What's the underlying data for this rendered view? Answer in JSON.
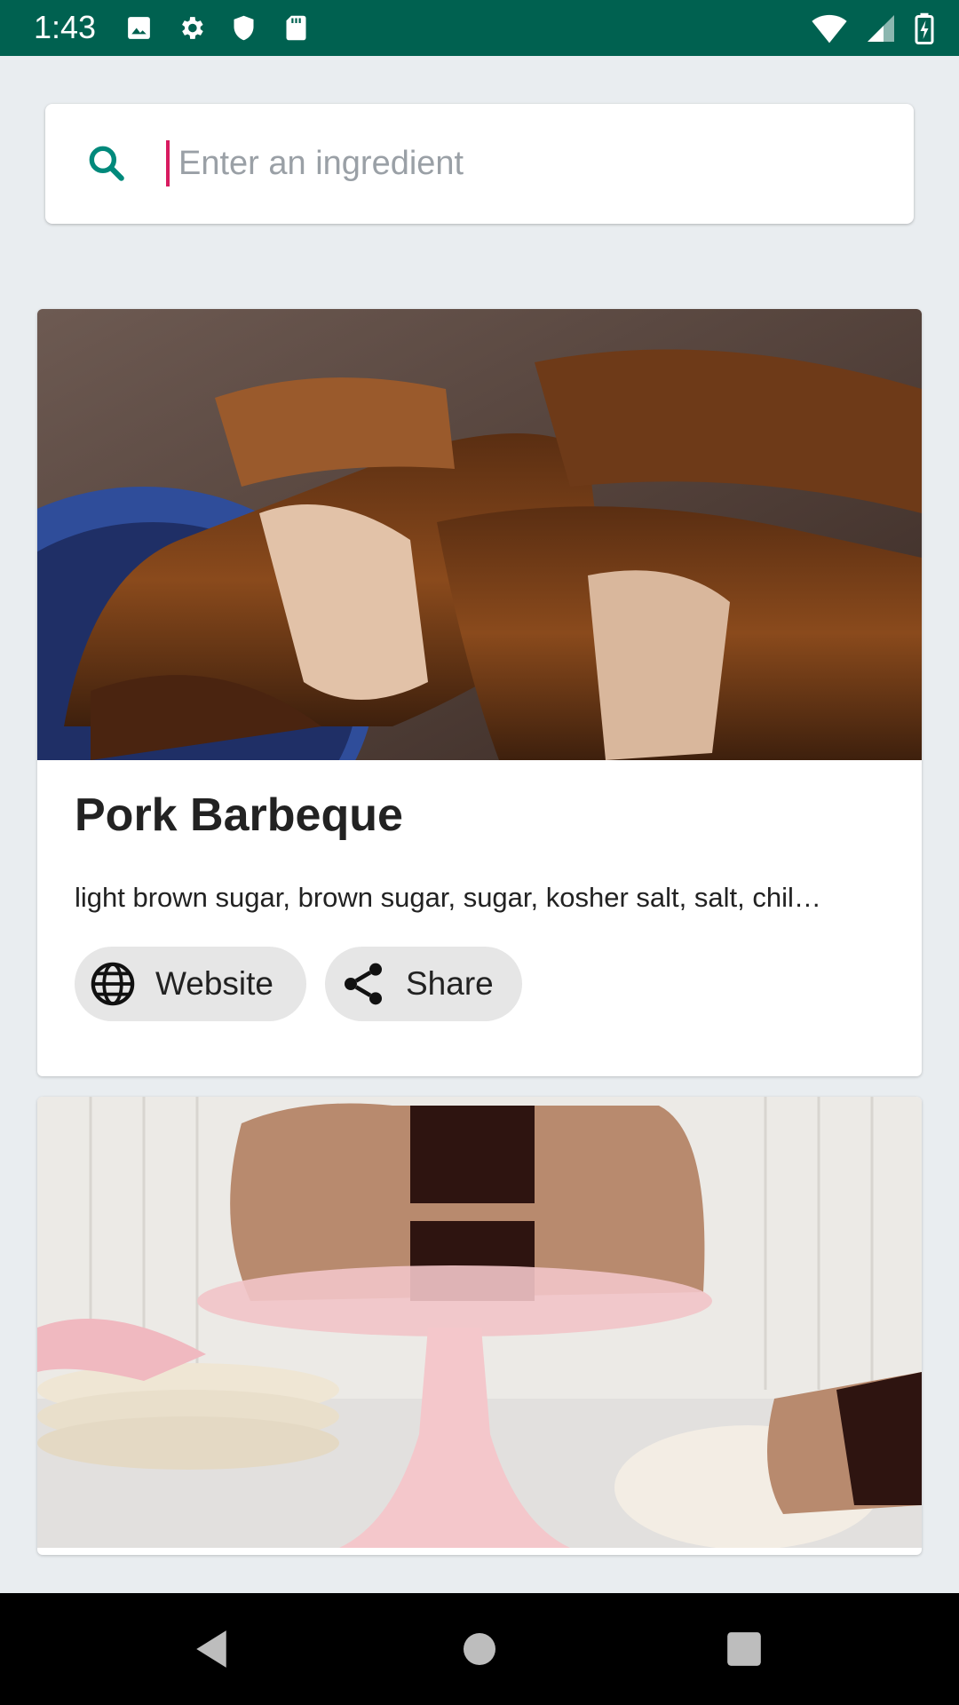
{
  "status_bar": {
    "time": "1:43",
    "left_icons": [
      "image-icon",
      "gear-icon",
      "shield-icon",
      "sd-card-icon"
    ],
    "right_icons": [
      "wifi-icon",
      "signal-icon",
      "battery-icon"
    ],
    "background_color": "#006150"
  },
  "search": {
    "placeholder": "Enter an ingredient",
    "value": "",
    "icon": "search-icon",
    "icon_color": "#00897b",
    "caret_color": "#d81b60"
  },
  "recipes": [
    {
      "title": "Pork Barbeque",
      "ingredients": "light brown sugar, brown sugar, sugar, kosher salt, salt, chil…",
      "actions": {
        "website_label": "Website",
        "share_label": "Share"
      }
    },
    {
      "title": "",
      "ingredients": "",
      "actions": {
        "website_label": "",
        "share_label": ""
      }
    }
  ],
  "nav_bar": {
    "buttons": [
      "back-icon",
      "home-icon",
      "recents-icon"
    ]
  }
}
